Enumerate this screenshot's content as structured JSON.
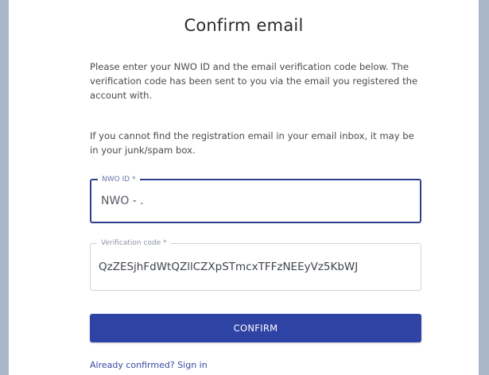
{
  "title": "Confirm email",
  "instructions": {
    "paragraph1": "Please enter your NWO ID and the email verification code below. The verification code has been sent to you via the email you registered the account with.",
    "paragraph2": "If you cannot find the registration email in your email inbox, it may be in your junk/spam box."
  },
  "form": {
    "nwo_id": {
      "label": "NWO ID *",
      "value": "NWO - ."
    },
    "verification_code": {
      "label": "Verification code *",
      "value": "QzZESjhFdWtQZllCZXpSTmcxTFFzNEEyVz5KbWJ"
    },
    "confirm_label": "CONFIRM"
  },
  "footer": {
    "signin_link": "Already confirmed? Sign in"
  },
  "colors": {
    "background": "#aab7cb",
    "primary": "#2f43a4",
    "focus_border": "#2f3f8f",
    "link": "#3949a0"
  }
}
